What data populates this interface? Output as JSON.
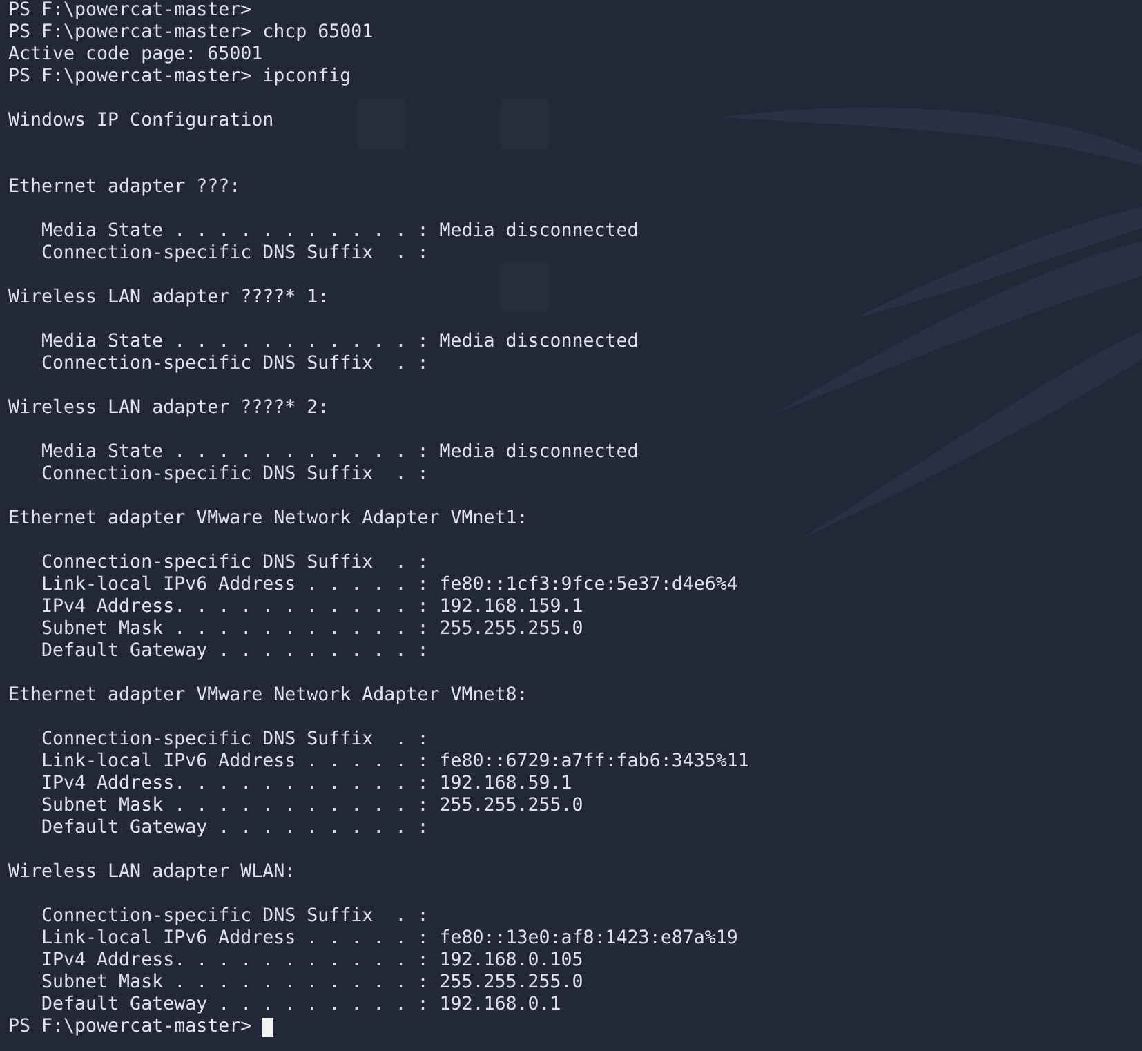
{
  "terminal": {
    "lines": [
      {
        "kind": "text",
        "text": "PS F:\\powercat-master>"
      },
      {
        "kind": "text",
        "text": "PS F:\\powercat-master> chcp 65001"
      },
      {
        "kind": "text",
        "text": "Active code page: 65001"
      },
      {
        "kind": "text",
        "text": "PS F:\\powercat-master> ipconfig"
      },
      {
        "kind": "blank"
      },
      {
        "kind": "text",
        "text": "Windows IP Configuration"
      },
      {
        "kind": "blank"
      },
      {
        "kind": "blank"
      },
      {
        "kind": "text",
        "text": "Ethernet adapter ???:"
      },
      {
        "kind": "blank"
      },
      {
        "kind": "text",
        "text": "   Media State . . . . . . . . . . . : Media disconnected"
      },
      {
        "kind": "text",
        "text": "   Connection-specific DNS Suffix  . :"
      },
      {
        "kind": "blank"
      },
      {
        "kind": "text",
        "text": "Wireless LAN adapter ????* 1:"
      },
      {
        "kind": "blank"
      },
      {
        "kind": "text",
        "text": "   Media State . . . . . . . . . . . : Media disconnected"
      },
      {
        "kind": "text",
        "text": "   Connection-specific DNS Suffix  . :"
      },
      {
        "kind": "blank"
      },
      {
        "kind": "text",
        "text": "Wireless LAN adapter ????* 2:"
      },
      {
        "kind": "blank"
      },
      {
        "kind": "text",
        "text": "   Media State . . . . . . . . . . . : Media disconnected"
      },
      {
        "kind": "text",
        "text": "   Connection-specific DNS Suffix  . :"
      },
      {
        "kind": "blank"
      },
      {
        "kind": "text",
        "text": "Ethernet adapter VMware Network Adapter VMnet1:"
      },
      {
        "kind": "blank"
      },
      {
        "kind": "text",
        "text": "   Connection-specific DNS Suffix  . :"
      },
      {
        "kind": "text",
        "text": "   Link-local IPv6 Address . . . . . : fe80::1cf3:9fce:5e37:d4e6%4"
      },
      {
        "kind": "text",
        "text": "   IPv4 Address. . . . . . . . . . . : 192.168.159.1"
      },
      {
        "kind": "text",
        "text": "   Subnet Mask . . . . . . . . . . . : 255.255.255.0"
      },
      {
        "kind": "text",
        "text": "   Default Gateway . . . . . . . . . :"
      },
      {
        "kind": "blank"
      },
      {
        "kind": "text",
        "text": "Ethernet adapter VMware Network Adapter VMnet8:"
      },
      {
        "kind": "blank"
      },
      {
        "kind": "text",
        "text": "   Connection-specific DNS Suffix  . :"
      },
      {
        "kind": "text",
        "text": "   Link-local IPv6 Address . . . . . : fe80::6729:a7ff:fab6:3435%11"
      },
      {
        "kind": "text",
        "text": "   IPv4 Address. . . . . . . . . . . : 192.168.59.1"
      },
      {
        "kind": "text",
        "text": "   Subnet Mask . . . . . . . . . . . : 255.255.255.0"
      },
      {
        "kind": "text",
        "text": "   Default Gateway . . . . . . . . . :"
      },
      {
        "kind": "blank"
      },
      {
        "kind": "text",
        "text": "Wireless LAN adapter WLAN:"
      },
      {
        "kind": "blank"
      },
      {
        "kind": "text",
        "text": "   Connection-specific DNS Suffix  . :"
      },
      {
        "kind": "text",
        "text": "   Link-local IPv6 Address . . . . . : fe80::13e0:af8:1423:e87a%19"
      },
      {
        "kind": "text",
        "text": "   IPv4 Address. . . . . . . . . . . : 192.168.0.105"
      },
      {
        "kind": "text",
        "text": "   Subnet Mask . . . . . . . . . . . : 255.255.255.0"
      },
      {
        "kind": "text",
        "text": "   Default Gateway . . . . . . . . . : 192.168.0.1"
      },
      {
        "kind": "text",
        "text": "PS F:\\powercat-master>",
        "cursor": true
      }
    ]
  }
}
